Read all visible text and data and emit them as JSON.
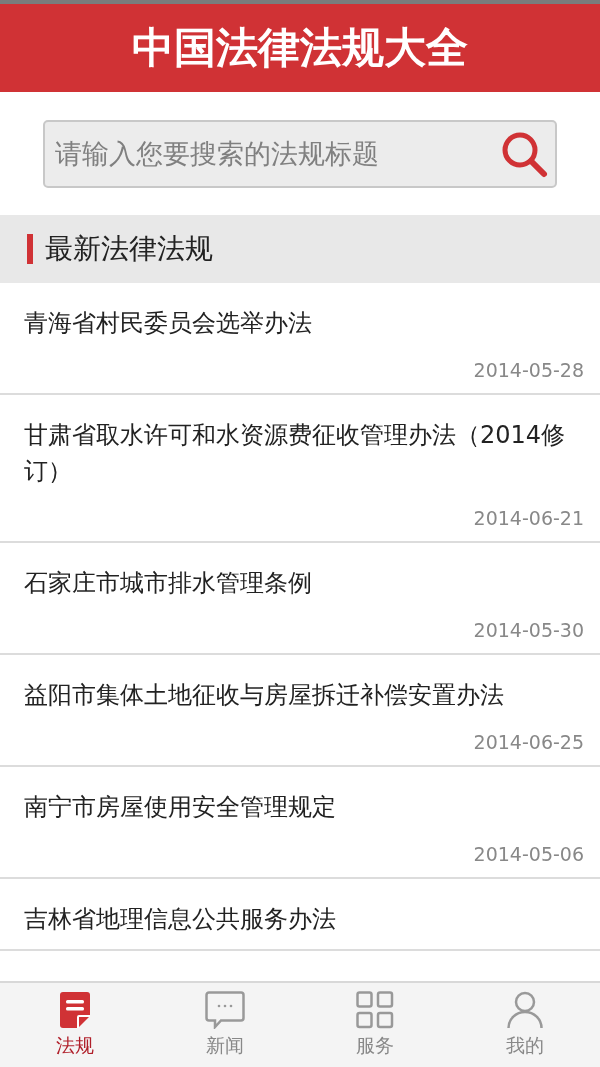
{
  "header": {
    "title": "中国法律法规大全"
  },
  "search": {
    "placeholder": "请输入您要搜索的法规标题"
  },
  "section": {
    "title": "最新法律法规"
  },
  "laws": [
    {
      "title": "青海省村民委员会选举办法",
      "date": "2014-05-28"
    },
    {
      "title": "甘肃省取水许可和水资源费征收管理办法（2014修订）",
      "date": "2014-06-21"
    },
    {
      "title": "石家庄市城市排水管理条例",
      "date": "2014-05-30"
    },
    {
      "title": "益阳市集体土地征收与房屋拆迁补偿安置办法",
      "date": "2014-06-25"
    },
    {
      "title": "南宁市房屋使用安全管理规定",
      "date": "2014-05-06"
    },
    {
      "title": "吉林省地理信息公共服务办法"
    }
  ],
  "tabs": [
    {
      "label": "法规",
      "kind": "document",
      "selected": true
    },
    {
      "label": "新闻",
      "kind": "chat",
      "selected": false
    },
    {
      "label": "服务",
      "kind": "grid",
      "selected": false
    },
    {
      "label": "我的",
      "kind": "person",
      "selected": false
    }
  ]
}
